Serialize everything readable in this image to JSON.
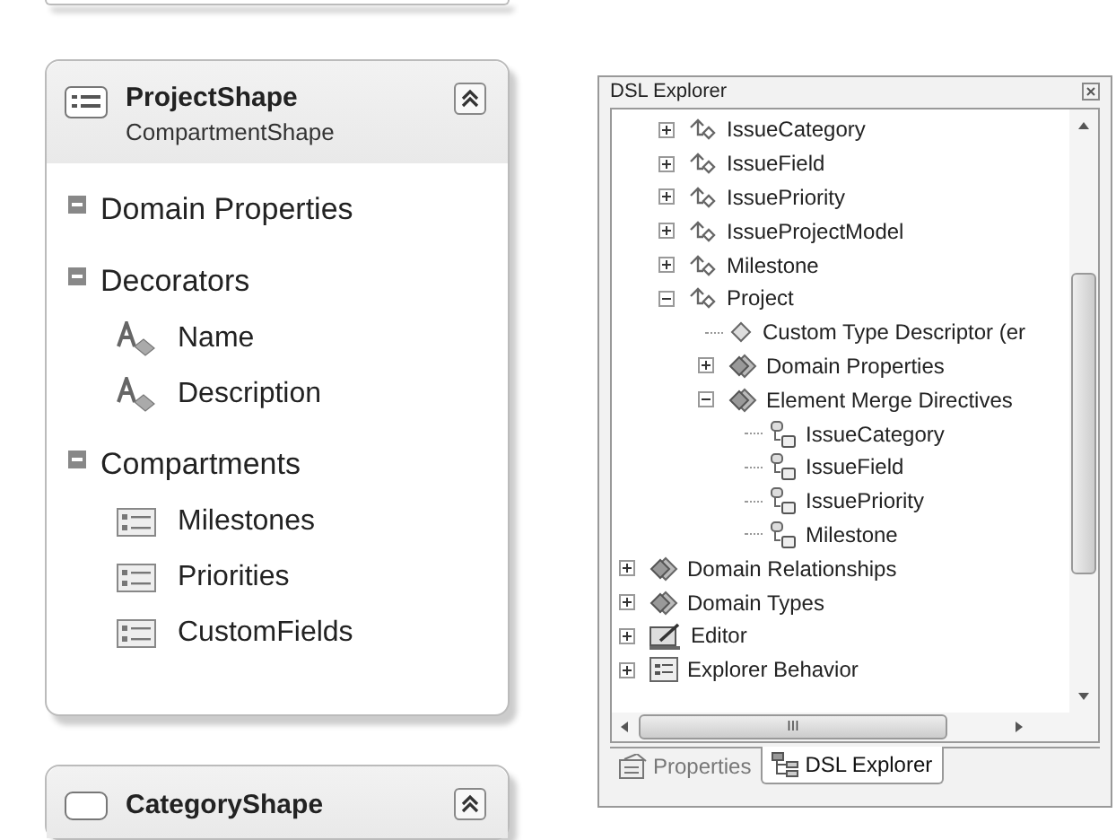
{
  "diagram": {
    "project_shape": {
      "title": "ProjectShape",
      "subtitle": "CompartmentShape",
      "sections": [
        {
          "label": "Domain Properties",
          "expanded": true
        },
        {
          "label": "Decorators",
          "expanded": true,
          "items": [
            {
              "kind": "text",
              "label": "Name"
            },
            {
              "kind": "text",
              "label": "Description"
            }
          ]
        },
        {
          "label": "Compartments",
          "expanded": true,
          "items": [
            {
              "kind": "compartment",
              "label": "Milestones"
            },
            {
              "kind": "compartment",
              "label": "Priorities"
            },
            {
              "kind": "compartment",
              "label": "CustomFields"
            }
          ]
        }
      ]
    },
    "category_shape": {
      "title": "CategoryShape"
    }
  },
  "explorer": {
    "title": "DSL Explorer",
    "tree": {
      "branch_items": [
        {
          "kind": "class",
          "label": "IssueCategory",
          "expanded": false
        },
        {
          "kind": "class",
          "label": "IssueField",
          "expanded": false
        },
        {
          "kind": "class",
          "label": "IssuePriority",
          "expanded": false
        },
        {
          "kind": "class",
          "label": "IssueProjectModel",
          "expanded": false
        },
        {
          "kind": "class",
          "label": "Milestone",
          "expanded": false
        },
        {
          "kind": "class",
          "label": "Project",
          "expanded": true,
          "children": [
            {
              "kind": "descriptor",
              "label": "Custom Type Descriptor (er"
            },
            {
              "kind": "folder",
              "label": "Domain Properties",
              "expanded": false
            },
            {
              "kind": "folder",
              "label": "Element Merge Directives",
              "expanded": true,
              "children": [
                {
                  "kind": "merge",
                  "label": "IssueCategory"
                },
                {
                  "kind": "merge",
                  "label": "IssueField"
                },
                {
                  "kind": "merge",
                  "label": "IssuePriority"
                },
                {
                  "kind": "merge",
                  "label": "Milestone"
                }
              ]
            }
          ]
        }
      ],
      "root_items": [
        {
          "kind": "folder",
          "label": "Domain Relationships",
          "expanded": false
        },
        {
          "kind": "folder",
          "label": "Domain Types",
          "expanded": false
        },
        {
          "kind": "editor",
          "label": "Editor",
          "expanded": false
        },
        {
          "kind": "behavior",
          "label": "Explorer Behavior",
          "expanded": false
        }
      ]
    },
    "scroll_arrow_text": "III",
    "tabs": [
      {
        "kind": "properties",
        "label": "Properties",
        "selected": false
      },
      {
        "kind": "explorer",
        "label": "DSL Explorer",
        "selected": true
      }
    ]
  }
}
